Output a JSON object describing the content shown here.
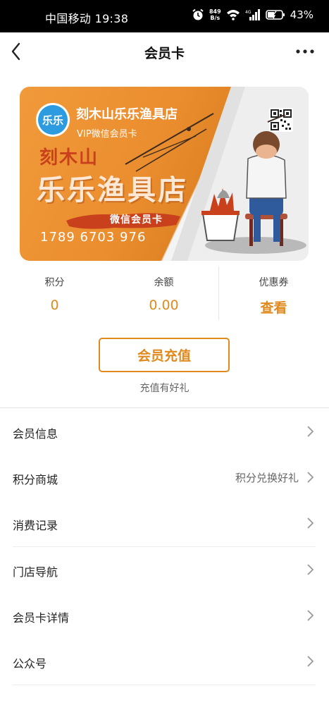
{
  "status_bar": {
    "carrier_time": "中国移动 19:38",
    "speed_top": "849",
    "speed_bottom": "B/s",
    "battery": "43%"
  },
  "nav": {
    "title": "会员卡",
    "back_icon": "chevron-left-icon",
    "more_icon": "more-dots-icon"
  },
  "card": {
    "logo_text": "乐乐",
    "store_name": "刻木山乐乐渔具店",
    "subtitle": "VIP微信会员卡",
    "big_line1": "刻木山",
    "big_line2": "乐乐渔具店",
    "badge": "微信会员卡",
    "number": "1789 6703 976",
    "qr_icon": "qr-code-icon"
  },
  "stats": [
    {
      "label": "积分",
      "value": "0"
    },
    {
      "label": "余额",
      "value": "0.00"
    },
    {
      "label": "优惠券",
      "value": "查看"
    }
  ],
  "recharge": {
    "button": "会员充值",
    "tip": "充值有好礼"
  },
  "menu": [
    {
      "label": "会员信息",
      "extra": ""
    },
    {
      "label": "积分商城",
      "extra": "积分兑换好礼"
    },
    {
      "label": "消费记录",
      "extra": ""
    },
    {
      "label": "门店导航",
      "extra": ""
    },
    {
      "label": "会员卡详情",
      "extra": ""
    },
    {
      "label": "公众号",
      "extra": ""
    }
  ],
  "colors": {
    "accent": "#e08a1e",
    "card_orange": "#ea8d2e",
    "logo_blue": "#2d9be0"
  }
}
